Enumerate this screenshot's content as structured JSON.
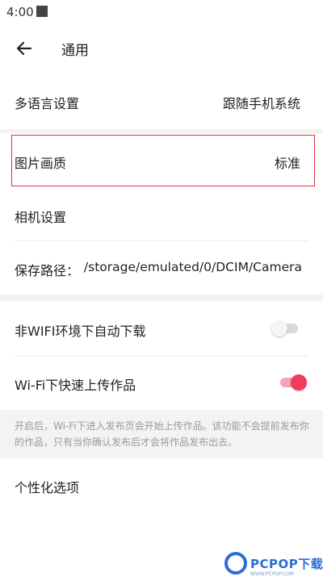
{
  "status_bar": {
    "time": "4:00"
  },
  "header": {
    "title": "通用"
  },
  "settings": {
    "language": {
      "label": "多语言设置",
      "value": "跟随手机系统"
    },
    "image_quality": {
      "label": "图片画质",
      "value": "标准"
    },
    "camera": {
      "label": "相机设置"
    },
    "save_path": {
      "label": "保存路径：",
      "value": "/storage/emulated/0/DCIM/Camera"
    },
    "auto_download": {
      "label": "非WIFI环境下自动下载",
      "enabled": false
    },
    "fast_upload": {
      "label": "Wi-Fi下快速上传作品",
      "enabled": true
    },
    "upload_note": "开启后，Wi-Fi下进入发布页会开始上传作品。该功能不会提前发布你的作品，只有当你确认发布后才会将作品发布出去。",
    "personalization": {
      "label": "个性化选项"
    }
  },
  "watermark": {
    "brand": "PCPOP下载",
    "subtext": "WWW.PCPOP.COM"
  },
  "colors": {
    "accent": "#f03c5a",
    "highlight": "#e0303b",
    "toggle_off": "#d9d9d9"
  }
}
